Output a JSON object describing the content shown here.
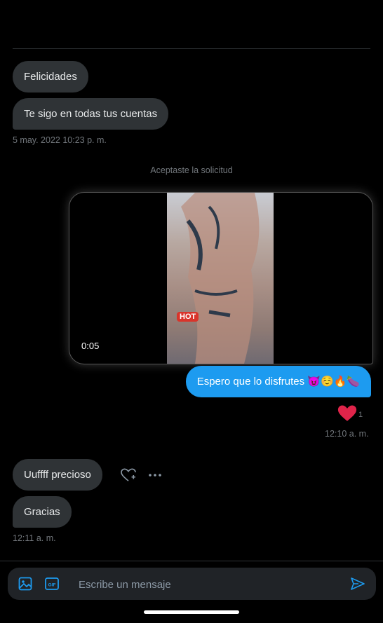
{
  "conversation": {
    "messages_top": [
      {
        "text": "Felicidades"
      },
      {
        "text": "Te sigo en todas tus cuentas"
      }
    ],
    "timestamp_1": "5 may. 2022 10:23 p. m.",
    "system_notice": "Aceptaste la solicitud",
    "video": {
      "duration": "0:05",
      "overlay_text": "HOT"
    },
    "outgoing_message": "Espero que lo disfrutes 😈☺️🔥🍆",
    "reaction": {
      "emoji_name": "heart-icon",
      "count": "1"
    },
    "timestamp_2": "12:10 a. m.",
    "messages_bottom": [
      {
        "text": "Uuffff precioso"
      },
      {
        "text": "Gracias"
      }
    ],
    "timestamp_3": "12:11 a. m."
  },
  "composer": {
    "placeholder": "Escribe un mensaje",
    "gif_label": "GIF"
  },
  "colors": {
    "accent": "#1d9bf0",
    "incoming_bubble": "#2f3336",
    "reaction_heart": "#f91880"
  }
}
